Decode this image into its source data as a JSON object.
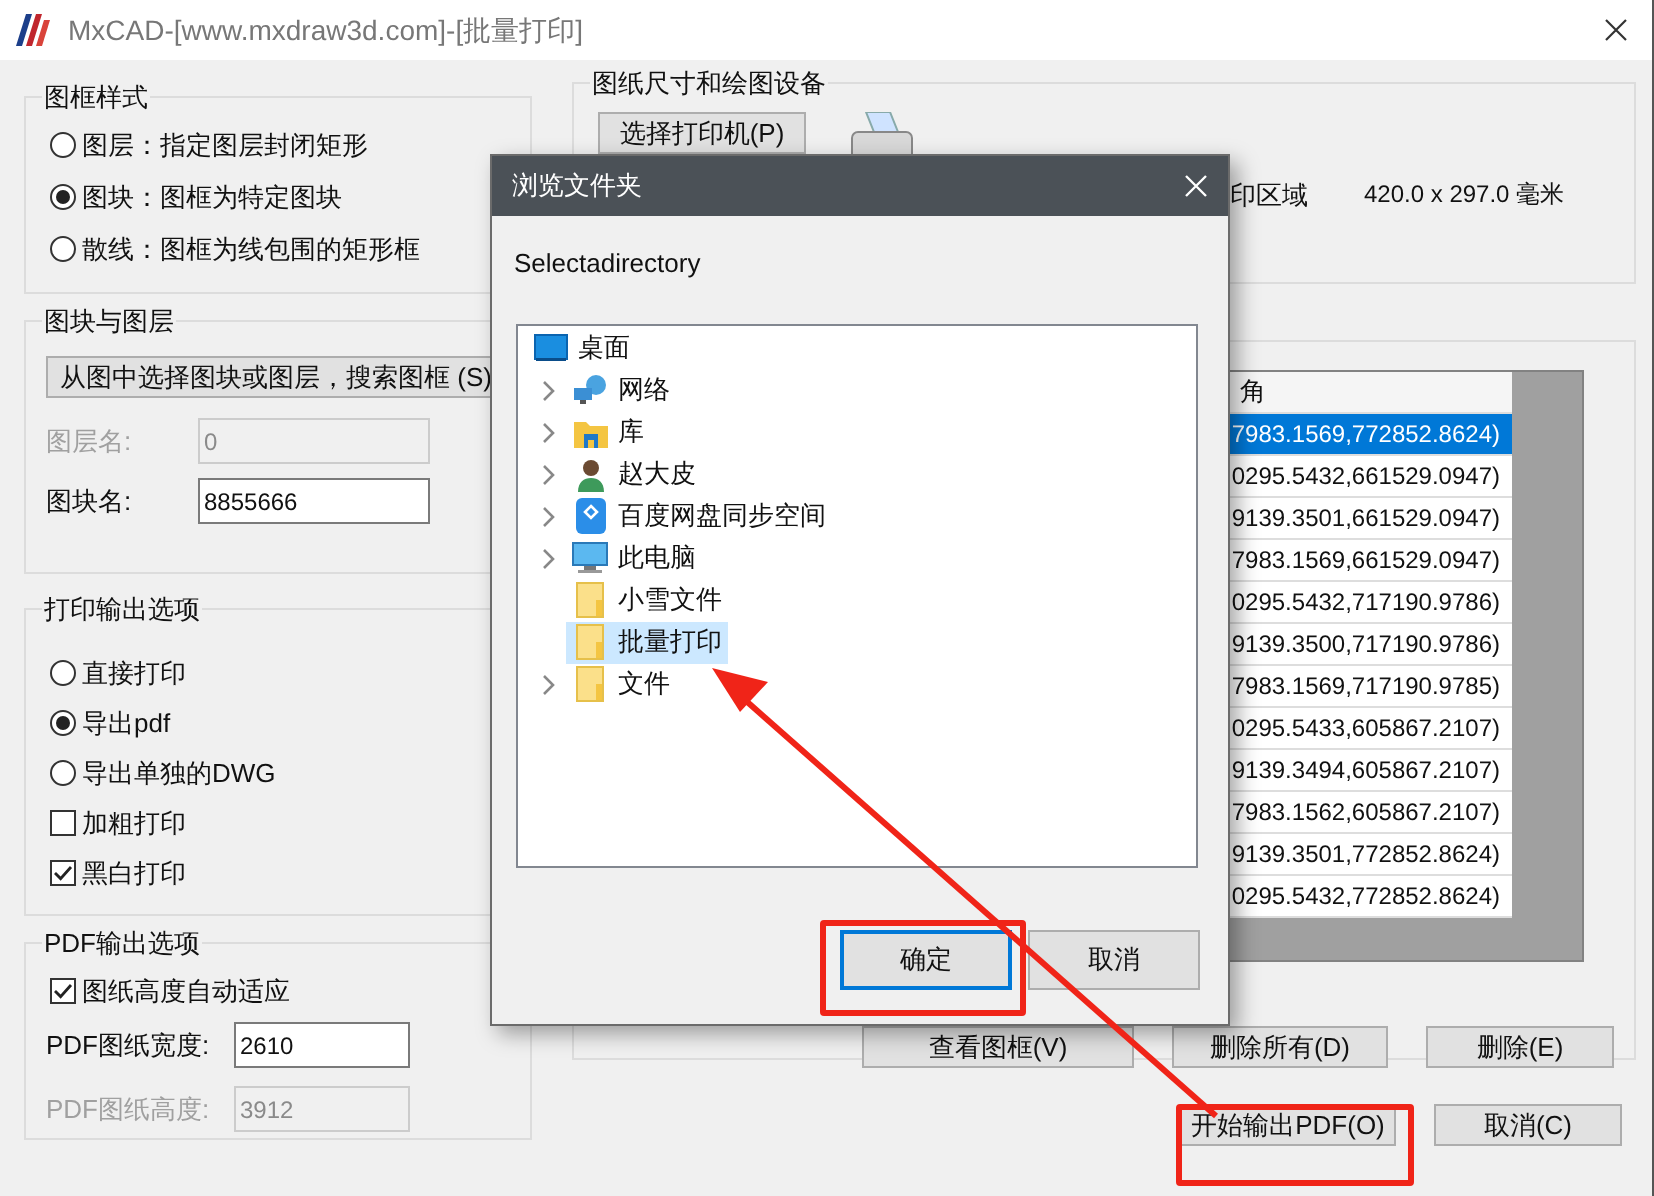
{
  "window": {
    "title": "MxCAD-[www.mxdraw3d.com]-[批量打印]"
  },
  "frame_style": {
    "title": "图框样式",
    "options": [
      {
        "label": "图层：指定图层封闭矩形",
        "selected": false
      },
      {
        "label": "图块：图框为特定图块",
        "selected": true
      },
      {
        "label": "散线：图框为线包围的矩形框",
        "selected": false
      }
    ]
  },
  "block_layer": {
    "title": "图块与图层",
    "button": "从图中选择图块或图层，搜索图框 (S)",
    "fields": [
      {
        "label": "图层名:",
        "value": "0",
        "disabled": true
      },
      {
        "label": "图块名:",
        "value": "8855666",
        "disabled": false
      }
    ]
  },
  "print_output": {
    "title": "打印输出选项",
    "options": [
      {
        "kind": "radio",
        "label": "直接打印",
        "selected": false
      },
      {
        "kind": "radio",
        "label": "导出pdf",
        "selected": true
      },
      {
        "kind": "radio",
        "label": "导出单独的DWG",
        "selected": false
      },
      {
        "kind": "checkbox",
        "label": "加粗打印",
        "checked": false
      },
      {
        "kind": "checkbox",
        "label": "黑白打印",
        "checked": true
      }
    ]
  },
  "pdf_output": {
    "title": "PDF输出选项",
    "auto_height": {
      "label": "图纸高度自动适应",
      "checked": true
    },
    "fields": [
      {
        "label": "PDF图纸宽度:",
        "value": "2610",
        "disabled": false
      },
      {
        "label": "PDF图纸高度:",
        "value": "3912",
        "disabled": true
      }
    ]
  },
  "paper_device": {
    "title": "图纸尺寸和绘图设备",
    "printer_button": "选择打印机(P)",
    "area_label": "印区域",
    "area_value": "420.0 x 297.0 毫米"
  },
  "frames_table": {
    "column": "角",
    "rows": [
      {
        "text": "7983.1569,772852.8624)",
        "selected": true
      },
      {
        "text": "0295.5432,661529.0947)",
        "selected": false
      },
      {
        "text": "9139.3501,661529.0947)",
        "selected": false
      },
      {
        "text": "7983.1569,661529.0947)",
        "selected": false
      },
      {
        "text": "0295.5432,717190.9786)",
        "selected": false
      },
      {
        "text": "9139.3500,717190.9786)",
        "selected": false
      },
      {
        "text": "7983.1569,717190.9785)",
        "selected": false
      },
      {
        "text": "0295.5433,605867.2107)",
        "selected": false
      },
      {
        "text": "9139.3494,605867.2107)",
        "selected": false
      },
      {
        "text": "7983.1562,605867.2107)",
        "selected": false
      },
      {
        "text": "9139.3501,772852.8624)",
        "selected": false
      },
      {
        "text": "0295.5432,772852.8624)",
        "selected": false
      }
    ]
  },
  "table_buttons": [
    "查看图框(V)",
    "删除所有(D)",
    "删除(E)"
  ],
  "footer_buttons": [
    "开始输出PDF(O)",
    "取消(C)"
  ],
  "dialog": {
    "title": "浏览文件夹",
    "prompt": "Selectadirectory",
    "tree": [
      {
        "label": "桌面",
        "kind": "desktop",
        "selected": false,
        "children": [
          {
            "label": "网络",
            "kind": "network",
            "expandable": true,
            "selected": false
          },
          {
            "label": "库",
            "kind": "library",
            "expandable": true,
            "selected": false
          },
          {
            "label": "赵大皮",
            "kind": "user",
            "expandable": true,
            "selected": false
          },
          {
            "label": "百度网盘同步空间",
            "kind": "cloud",
            "expandable": true,
            "selected": false
          },
          {
            "label": "此电脑",
            "kind": "computer",
            "expandable": true,
            "selected": false
          },
          {
            "label": "小雪文件",
            "kind": "folder",
            "expandable": false,
            "selected": false
          },
          {
            "label": "批量打印",
            "kind": "folder",
            "expandable": false,
            "selected": true
          },
          {
            "label": "文件",
            "kind": "folder",
            "expandable": true,
            "selected": false
          }
        ]
      }
    ],
    "buttons": [
      {
        "label": "确定",
        "focused": true
      },
      {
        "label": "取消",
        "focused": false
      }
    ]
  }
}
